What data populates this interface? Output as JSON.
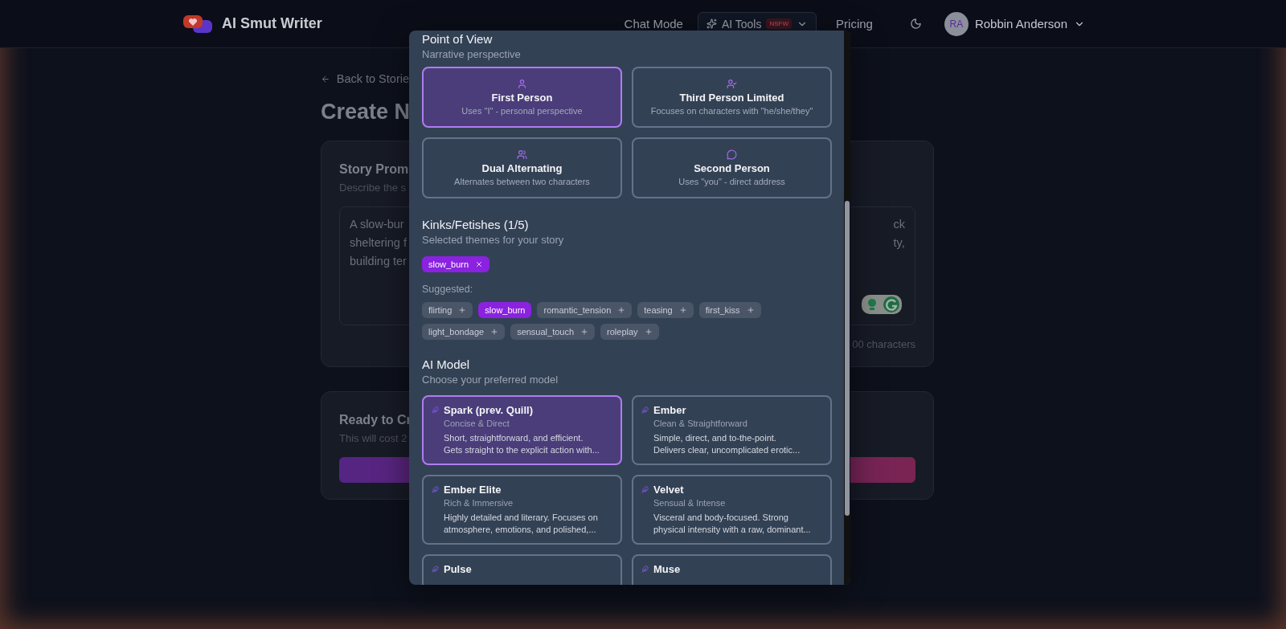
{
  "header": {
    "brand": "AI Smut Writer",
    "nav": [
      {
        "label": "Chat Mode"
      }
    ],
    "ai_tools": {
      "label": "AI Tools",
      "badge": "NSFW"
    },
    "pricing": "Pricing",
    "user": {
      "initials": "RA",
      "name": "Robbin Anderson"
    }
  },
  "page": {
    "back_link": "Back to Storie",
    "title": "Create N",
    "prompt_card": {
      "title": "Story Prom",
      "hint": "Describe the s",
      "text_left": [
        "A slow-bur",
        "sheltering f",
        "building ter"
      ],
      "text_right": [
        "ck",
        "ty,"
      ],
      "counter": "00 characters"
    },
    "ready_card": {
      "title": "Ready to Cr",
      "hint": "This will cost 2"
    }
  },
  "modal": {
    "pov": {
      "title": "Point of View",
      "subtitle": "Narrative perspective",
      "options": [
        {
          "kind": "user",
          "title": "First Person",
          "desc": "Uses \"I\" - personal perspective",
          "selected": true
        },
        {
          "kind": "user-check",
          "title": "Third Person Limited",
          "desc": "Focuses on characters with \"he/she/they\"",
          "selected": false
        },
        {
          "kind": "users",
          "title": "Dual Alternating",
          "desc": "Alternates between two characters",
          "selected": false
        },
        {
          "kind": "message",
          "title": "Second Person",
          "desc": "Uses \"you\" - direct address",
          "selected": false
        }
      ]
    },
    "kinks": {
      "title": "Kinks/Fetishes (1/5)",
      "subtitle": "Selected themes for your story",
      "selected_tags": [
        "slow_burn"
      ],
      "suggested_label": "Suggested:",
      "suggested": [
        {
          "label": "flirting",
          "selected": false
        },
        {
          "label": "slow_burn",
          "selected": true
        },
        {
          "label": "romantic_tension",
          "selected": false
        },
        {
          "label": "teasing",
          "selected": false
        },
        {
          "label": "first_kiss",
          "selected": false
        },
        {
          "label": "light_bondage",
          "selected": false
        },
        {
          "label": "sensual_touch",
          "selected": false
        },
        {
          "label": "roleplay",
          "selected": false
        }
      ]
    },
    "model": {
      "title": "AI Model",
      "subtitle": "Choose your preferred model",
      "options": [
        {
          "name": "Spark (prev. Quill)",
          "tagline": "Concise & Direct",
          "desc": [
            "Short, straightforward, and efficient.",
            "Gets straight to the explicit action with..."
          ],
          "selected": true
        },
        {
          "name": "Ember",
          "tagline": "Clean & Straightforward",
          "desc": [
            "Simple, direct, and to-the-point.",
            "Delivers clear, uncomplicated erotic..."
          ],
          "selected": false
        },
        {
          "name": "Ember Elite",
          "tagline": "Rich & Immersive",
          "desc": [
            "Highly detailed and literary. Focuses on",
            "atmosphere, emotions, and polished,..."
          ],
          "selected": false
        },
        {
          "name": "Velvet",
          "tagline": "Sensual & Intense",
          "desc": [
            "Visceral and body-focused. Strong",
            "physical intensity with a raw, dominant..."
          ],
          "selected": false
        },
        {
          "name": "Pulse",
          "selected": false
        },
        {
          "name": "Muse",
          "selected": false
        }
      ]
    }
  }
}
